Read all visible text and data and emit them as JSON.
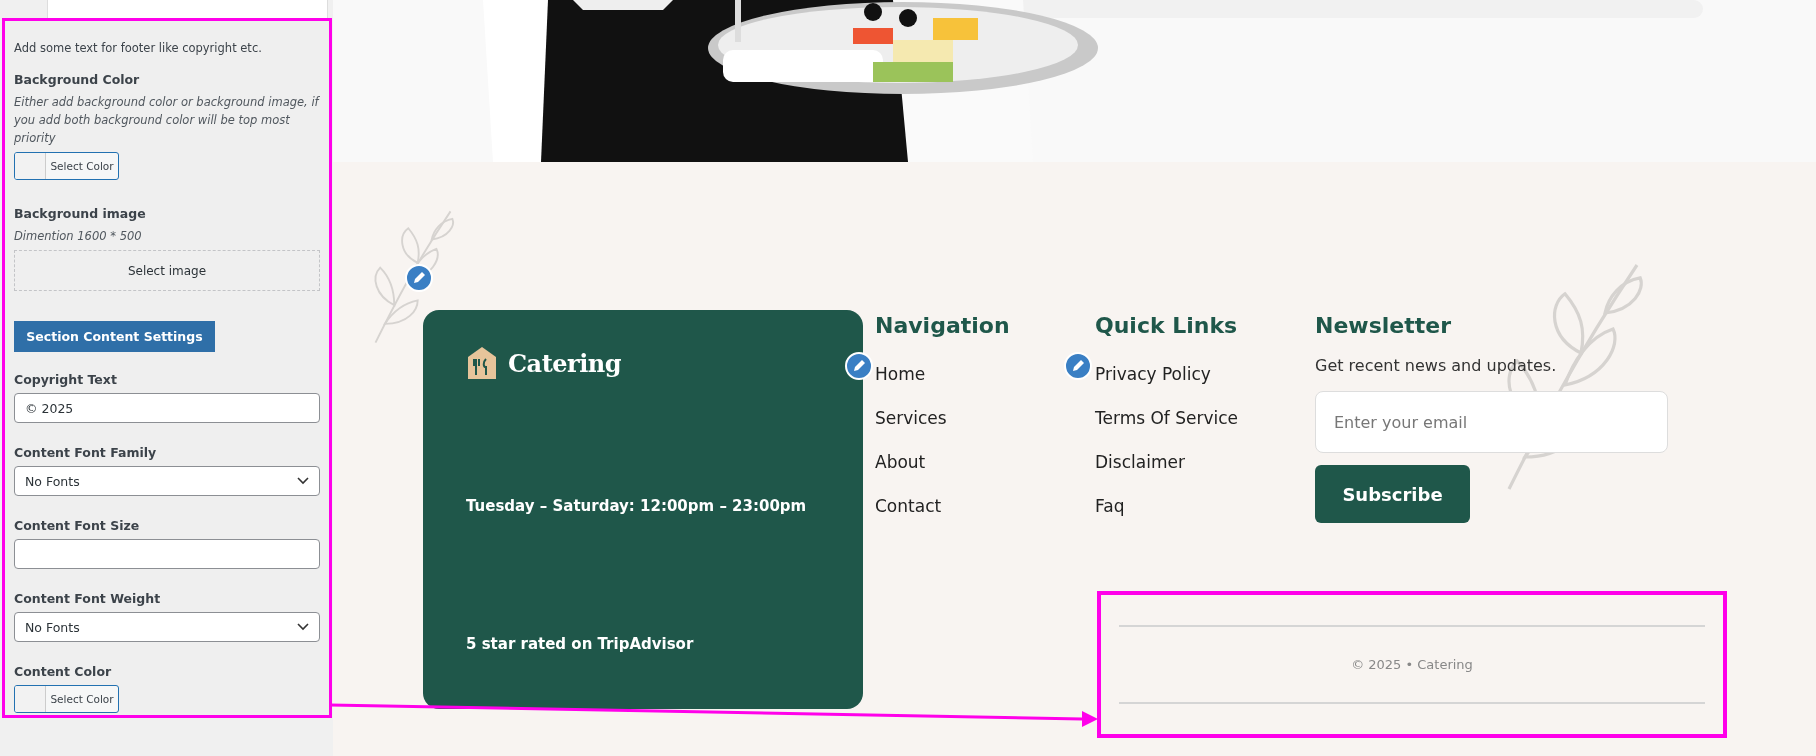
{
  "settings_panel": {
    "intro": "Add some text for footer like copyright etc.",
    "fields": [
      {
        "kind": "color",
        "label": "Background Color",
        "hint": "Either add background color or background image, if you add both background color will be top most priority",
        "button": "Select Color"
      },
      {
        "label": "Background image",
        "hint": "Dimention 1600 * 500",
        "button": "Select image"
      },
      {
        "kind": "section",
        "button": "Section Content Settings"
      },
      {
        "kind": "text",
        "label": "Copyright Text",
        "value": "© 2025"
      },
      {
        "kind": "select",
        "label": "Content Font Family",
        "value": "No Fonts"
      },
      {
        "kind": "text",
        "label": "Content Font Size"
      },
      {
        "kind": "select",
        "label": "Content Font Weight",
        "value": "No Fonts"
      },
      {
        "kind": "color",
        "label": "Content Color",
        "button": "Select Color"
      }
    ]
  },
  "footer": {
    "brand": {
      "logo": "Catering",
      "hours": "Tuesday – Saturday: 12:00pm – 23:00pm",
      "rating": "5 star rated on TripAdvisor"
    },
    "columns": [
      {
        "title": "Navigation",
        "links": [
          "Home",
          "Services",
          "About",
          "Contact"
        ]
      },
      {
        "title": "Quick Links",
        "links": [
          "Privacy Policy",
          "Terms Of Service",
          "Disclaimer",
          "Faq"
        ]
      }
    ],
    "newsletter": {
      "title": "Newsletter",
      "text": "Get recent news and updates.",
      "placeholder": "Enter your email",
      "button": "Subscribe"
    },
    "copyright": "© 2025 • Catering"
  }
}
